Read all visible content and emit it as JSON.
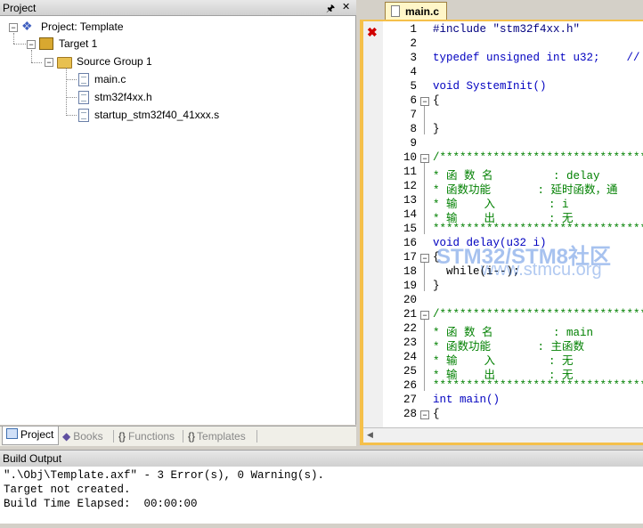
{
  "project_panel": {
    "title": "Project",
    "pin_icon": "pin-icon",
    "close_icon": "close-icon",
    "tree": {
      "project": "Project: Template",
      "target": "Target 1",
      "group": "Source Group 1",
      "files": [
        "main.c",
        "stm32f4xx.h",
        "startup_stm32f40_41xxx.s"
      ]
    },
    "tabs": [
      "Project",
      "Books",
      "Functions",
      "Templates"
    ]
  },
  "editor": {
    "tab_label": "main.c",
    "line_numbers": [
      "1",
      "2",
      "3",
      "4",
      "5",
      "6",
      "7",
      "8",
      "9",
      "10",
      "11",
      "12",
      "13",
      "14",
      "15",
      "16",
      "17",
      "18",
      "19",
      "20",
      "21",
      "22",
      "23",
      "24",
      "25",
      "26",
      "27",
      "28"
    ],
    "lines": [
      "#include \"stm32f4xx.h\"",
      "",
      "typedef unsigned int u32;    //",
      "",
      "void SystemInit()",
      "{",
      "",
      "}",
      "",
      "/*************************************",
      "* 函 数 名         : delay",
      "* 函数功能       : 延时函数，通",
      "* 输    入        : i",
      "* 输    出        : 无",
      "*************************************",
      "void delay(u32 i)",
      "{",
      "  while(i--);",
      "}",
      "",
      "/*************************************",
      "* 函 数 名         : main",
      "* 函数功能       : 主函数",
      "* 输    入        : 无",
      "* 输    出        : 无",
      "*************************************",
      "int main()",
      "{"
    ]
  },
  "watermark": {
    "line1": "STM32/STM8社区",
    "line2": "www.stmcu.org"
  },
  "build_output": {
    "title": "Build Output",
    "lines": [
      "\".\\Obj\\Template.axf\" - 3 Error(s), 0 Warning(s).",
      "Target not created.",
      "Build Time Elapsed:  00:00:00"
    ]
  }
}
